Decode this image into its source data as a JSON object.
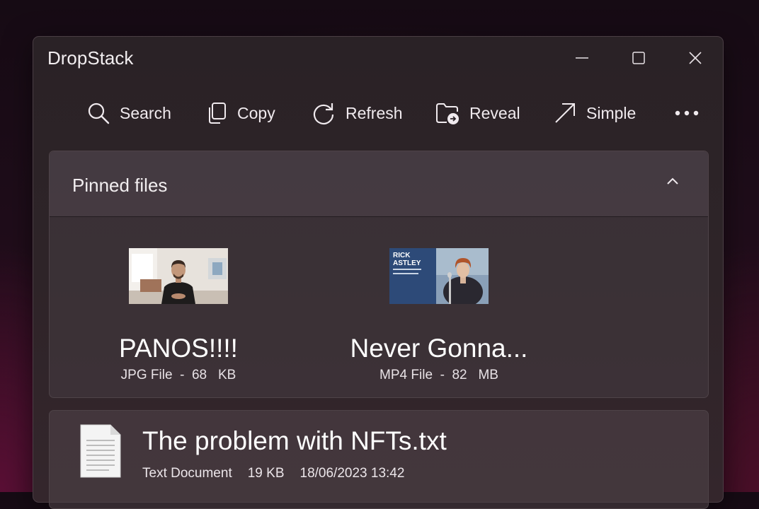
{
  "window": {
    "title": "DropStack"
  },
  "titlebar_buttons": {
    "minimize_icon": "minimize-icon",
    "maximize_icon": "maximize-icon",
    "close_icon": "close-icon"
  },
  "toolbar": {
    "search": {
      "label": "Search",
      "icon": "search-icon"
    },
    "copy": {
      "label": "Copy",
      "icon": "copy-icon"
    },
    "refresh": {
      "label": "Refresh",
      "icon": "refresh-icon"
    },
    "reveal": {
      "label": "Reveal",
      "icon": "folder-open-icon"
    },
    "simple": {
      "label": "Simple",
      "icon": "arrow-up-right-icon"
    },
    "more_icon": "more-dots-icon"
  },
  "pinned": {
    "title": "Pinned files",
    "collapse_icon": "chevron-up-icon",
    "items": [
      {
        "name": "PANOS!!!!",
        "type": "JPG File",
        "size": "68",
        "unit": "KB",
        "thumb": "person-in-room-photo"
      },
      {
        "name": "Never Gonna...",
        "type": "MP4 File",
        "size": "82",
        "unit": "MB",
        "thumb": "rick-astley-video",
        "thumb_text_1": "RICK",
        "thumb_text_2": "ASTLEY"
      }
    ]
  },
  "files": [
    {
      "name": "The problem with NFTs.txt",
      "type": "Text Document",
      "size": "19 KB",
      "date": "18/06/2023 13:42",
      "icon": "text-document-icon"
    }
  ],
  "colors": {
    "accent_text": "#ffffff",
    "window_bg": "#2b2327",
    "desktop_glow": "#5a0f35"
  }
}
